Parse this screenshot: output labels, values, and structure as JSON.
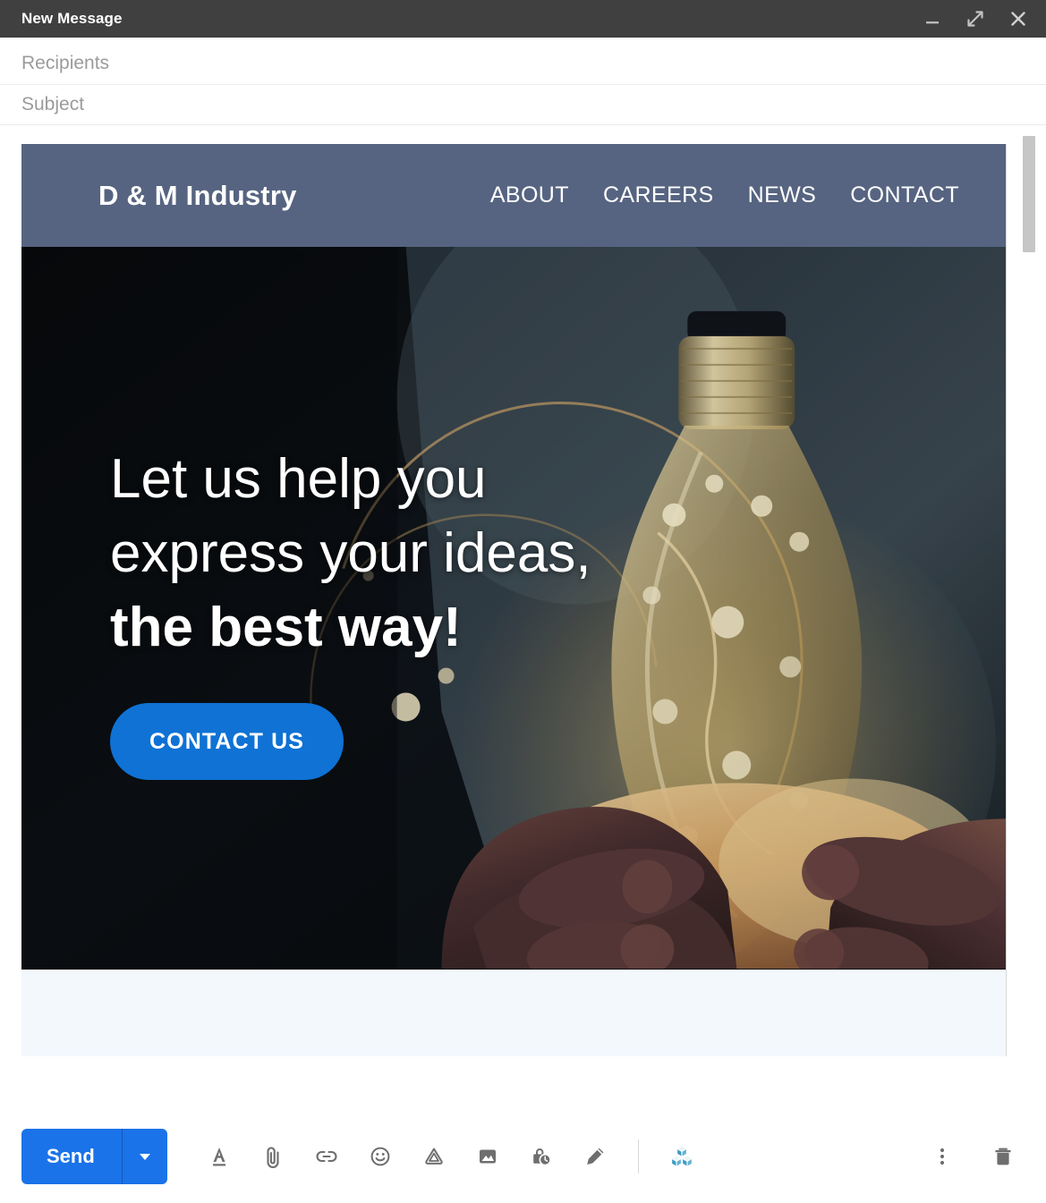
{
  "window": {
    "title": "New Message",
    "controls": [
      {
        "name": "minimize",
        "icon": "minimize-icon"
      },
      {
        "name": "expand",
        "icon": "expand-icon"
      },
      {
        "name": "close",
        "icon": "close-icon"
      }
    ]
  },
  "fields": {
    "recipients": {
      "label": "Recipients",
      "value": "",
      "placeholder": "Recipients"
    },
    "subject": {
      "label": "Subject",
      "value": "",
      "placeholder": "Subject"
    }
  },
  "email_body": {
    "site_nav": {
      "logo": "D & M Industry",
      "links": [
        "ABOUT",
        "CAREERS",
        "NEWS",
        "CONTACT"
      ],
      "background": "#566481"
    },
    "hero": {
      "heading_line1": "Let us help you",
      "heading_line2": "express your ideas,",
      "heading_line3": "the best way!",
      "cta_label": "CONTACT US",
      "cta_color": "#0f72d4",
      "image_alt": "hands holding a lightbulb filled with fairy lights"
    }
  },
  "toolbar": {
    "send_label": "Send",
    "send_color": "#1a73e8",
    "send_caret_icon": "chevron-down-icon",
    "tools": [
      {
        "name": "formatting-options",
        "icon": "format-text-icon"
      },
      {
        "name": "attach-files",
        "icon": "paperclip-icon"
      },
      {
        "name": "insert-link",
        "icon": "link-icon"
      },
      {
        "name": "insert-emoji",
        "icon": "emoji-icon"
      },
      {
        "name": "insert-drive-file",
        "icon": "google-drive-icon"
      },
      {
        "name": "insert-photo",
        "icon": "image-icon"
      },
      {
        "name": "confidential-mode",
        "icon": "lock-clock-icon"
      },
      {
        "name": "insert-signature",
        "icon": "pen-icon"
      }
    ],
    "addon": {
      "name": "addon-cubes",
      "icon": "cubes-icon",
      "color": "#3d9cc4"
    },
    "more_options": {
      "name": "more-options",
      "icon": "more-vert-icon"
    },
    "discard": {
      "name": "discard-draft",
      "icon": "trash-icon"
    }
  },
  "scrollbar": {
    "orientation": "vertical",
    "thumb_position_percent": 0
  }
}
